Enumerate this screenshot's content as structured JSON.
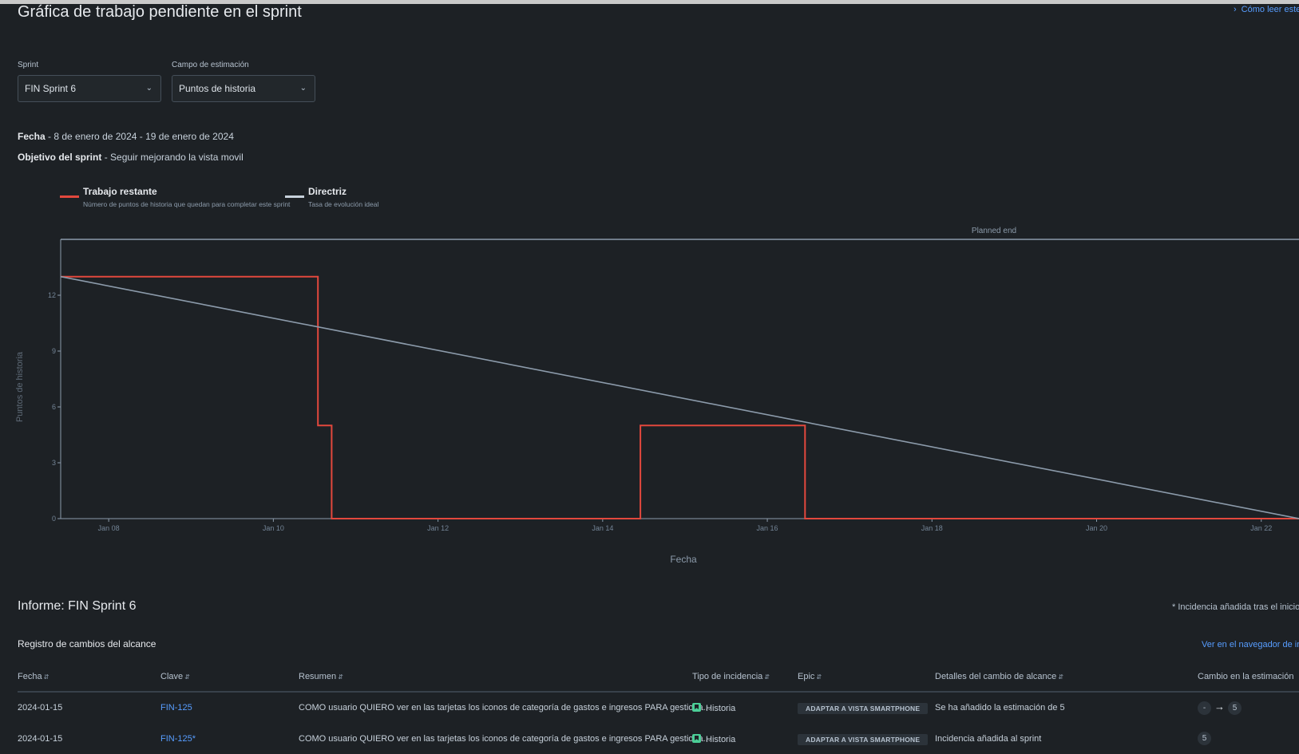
{
  "page": {
    "title": "Gráfica de trabajo pendiente en el sprint",
    "help_link": "Cómo leer este"
  },
  "filters": {
    "sprint_label": "Sprint",
    "sprint_value": "FIN Sprint 6",
    "estimation_label": "Campo de estimación",
    "estimation_value": "Puntos de historia"
  },
  "sprint_info": {
    "date_label": "Fecha",
    "date_value": " - 8 de enero de 2024 - 19 de enero de 2024",
    "goal_label": "Objetivo del sprint",
    "goal_value": " - Seguir mejorando la vista movil"
  },
  "legend": {
    "remaining_title": "Trabajo restante",
    "remaining_desc": "Número de puntos de historia que quedan para completar este sprint",
    "guideline_title": "Directriz",
    "guideline_desc": "Tasa de evolución ideal"
  },
  "colors": {
    "remaining": "#e2483d",
    "guideline": "#8c9bab",
    "link": "#579dff",
    "background": "#1d2125"
  },
  "chart_data": {
    "type": "line",
    "ylabel": "Puntos de historia",
    "xlabel": "Fecha",
    "annotation": "Planned end",
    "y_ticks": [
      0,
      3,
      6,
      9,
      12
    ],
    "x_ticks": [
      "Jan 08",
      "Jan 10",
      "Jan 12",
      "Jan 14",
      "Jan 16",
      "Jan 18",
      "Jan 20",
      "Jan 22"
    ],
    "xlim": [
      "2024-01-07 10:00",
      "2024-01-22 11:00"
    ],
    "ylim": [
      0,
      15
    ],
    "grid": false,
    "series": [
      {
        "name": "Trabajo restante",
        "step": true,
        "points": [
          [
            "2024-01-07 10:00",
            13
          ],
          [
            "2024-01-10 13:00",
            13
          ],
          [
            "2024-01-10 13:00",
            5
          ],
          [
            "2024-01-10 17:00",
            5
          ],
          [
            "2024-01-10 17:00",
            0
          ],
          [
            "2024-01-14 11:00",
            0
          ],
          [
            "2024-01-14 11:00",
            5
          ],
          [
            "2024-01-16 11:00",
            5
          ],
          [
            "2024-01-16 11:00",
            0
          ],
          [
            "2024-01-22 11:00",
            0
          ]
        ]
      },
      {
        "name": "Directriz",
        "points": [
          [
            "2024-01-07 10:00",
            13
          ],
          [
            "2024-01-22 11:00",
            0
          ]
        ]
      }
    ]
  },
  "report": {
    "title": "Informe: FIN Sprint 6",
    "footnote": "* Incidencia añadida tras el inicio d",
    "section_title": "Registro de cambios del alcance",
    "navigator_link": "Ver en el navegador de inc",
    "columns": {
      "date": "Fecha",
      "key": "Clave",
      "summary": "Resumen",
      "type": "Tipo de incidencia",
      "epic": "Epic",
      "details": "Detalles del cambio de alcance",
      "estimate": "Cambio en la estimación"
    },
    "rows": [
      {
        "date": "2024-01-15",
        "key": "FIN-125",
        "summary": "COMO usuario QUIERO ver en las tarjetas los iconos de categoría de gastos e ingresos PARA gestiona...",
        "type": "Historia",
        "epic": "ADAPTAR A VISTA SMARTPHONE",
        "details": "Se ha añadido la estimación de 5",
        "estimate_from": "-",
        "estimate_to": "5"
      },
      {
        "date": "2024-01-15",
        "key": "FIN-125*",
        "summary": "COMO usuario QUIERO ver en las tarjetas los iconos de categoría de gastos e ingresos PARA gestiona...",
        "type": "Historia",
        "epic": "ADAPTAR A VISTA SMARTPHONE",
        "details": "Incidencia añadida al sprint",
        "estimate_to": "5"
      }
    ]
  }
}
